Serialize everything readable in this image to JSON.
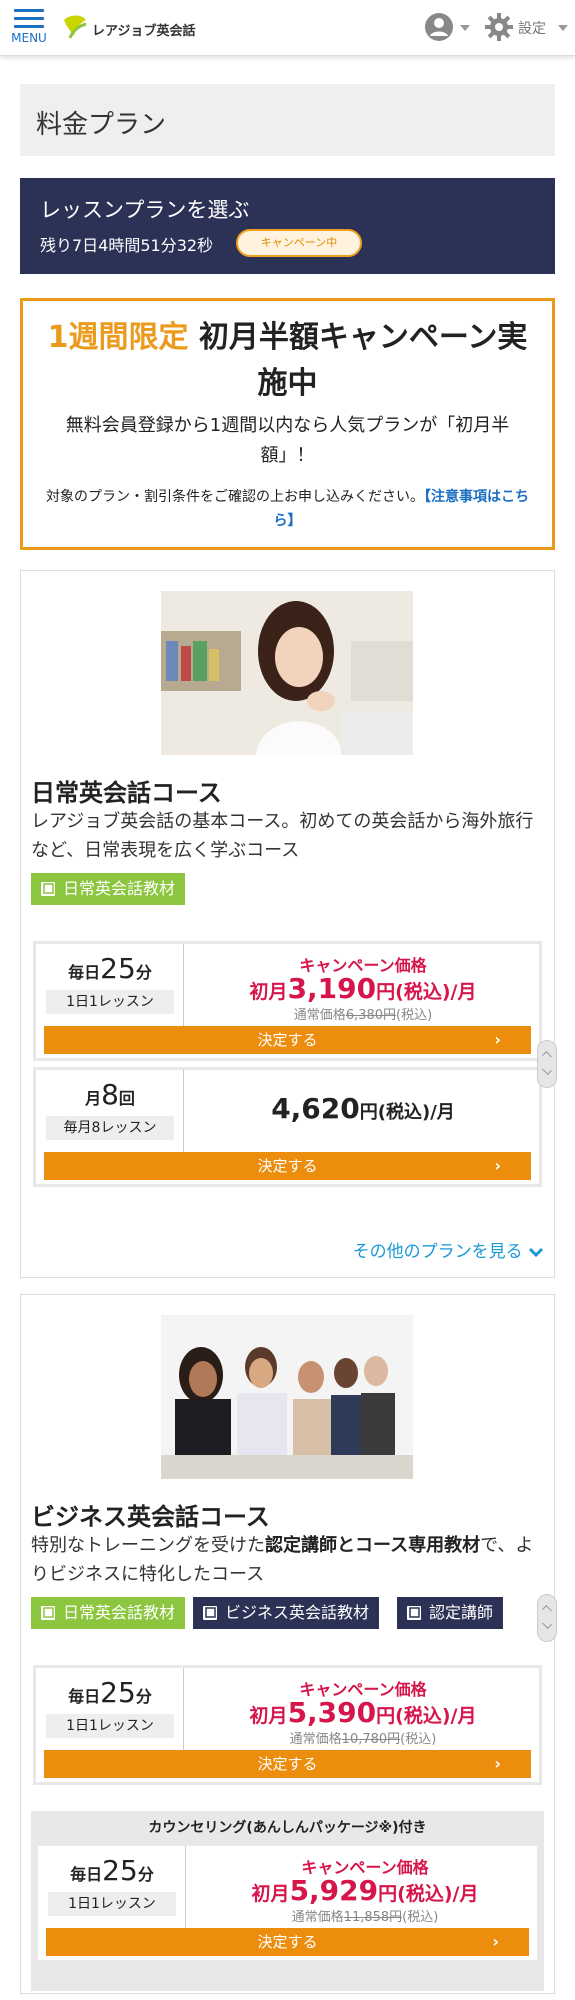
{
  "header": {
    "menu_label": "MENU",
    "logo_text": "レアジョブ英会話",
    "settings_label": "設定"
  },
  "page": {
    "title": "料金プラン"
  },
  "plan_bar": {
    "title": "レッスンプランを選ぶ",
    "countdown": "残り7日4時間51分32秒",
    "badge": "キャンペーン中"
  },
  "campaign": {
    "headline_highlight": "1週間限定",
    "headline_rest": " 初月半額キャンペーン実施中",
    "subtext": "無料会員登録から1週間以内なら人気プランが「初月半額」！",
    "note": "対象のプラン・割引条件をご確認の上お申し込みください。",
    "note_link": "【注意事項はこちら】"
  },
  "courses": [
    {
      "title": "日常英会話コース",
      "description": "レアジョブ英会話の基本コース。初めての英会話から海外旅行など、日常表現を広く学ぶコース",
      "tags": [
        "日常英会話教材"
      ],
      "plans": [
        {
          "freq_prefix": "毎日",
          "freq_num": "25",
          "freq_unit": "分",
          "lesson": "1日1レッスン",
          "campaign_label": "キャンペーン価格",
          "price_prefix": "初月",
          "price": "3,190",
          "price_suffix": "円(税込)/月",
          "regular_prefix": "通常価格",
          "regular_price": "6,380円",
          "regular_suffix": "(税込)",
          "button": "決定する"
        },
        {
          "freq_prefix": "月",
          "freq_num": "8",
          "freq_unit": "回",
          "lesson": "毎月8レッスン",
          "price": "4,620",
          "price_suffix": "円(税込)/月",
          "button": "決定する"
        }
      ],
      "more_link": "その他のプランを見る"
    },
    {
      "title": "ビジネス英会話コース",
      "description_pre": "特別なトレーニングを受けた",
      "description_bold": "認定講師とコース専用教材",
      "description_post": "で、よりビジネスに特化したコース",
      "tags": [
        "日常英会話教材",
        "ビジネス英会話教材",
        "認定講師"
      ],
      "plans": [
        {
          "freq_prefix": "毎日",
          "freq_num": "25",
          "freq_unit": "分",
          "lesson": "1日1レッスン",
          "campaign_label": "キャンペーン価格",
          "price_prefix": "初月",
          "price": "5,390",
          "price_suffix": "円(税込)/月",
          "regular_prefix": "通常価格",
          "regular_price": "10,780円",
          "regular_suffix": "(税込)",
          "button": "決定する"
        }
      ],
      "counseling": {
        "header": "カウンセリング(あんしんパッケージ※)付き",
        "plan": {
          "freq_prefix": "毎日",
          "freq_num": "25",
          "freq_unit": "分",
          "lesson": "1日1レッスン",
          "campaign_label": "キャンペーン価格",
          "price_prefix": "初月",
          "price": "5,929",
          "price_suffix": "円(税込)/月",
          "regular_prefix": "通常価格",
          "regular_price": "11,858円",
          "regular_suffix": "(税込)",
          "button": "決定する"
        }
      }
    }
  ],
  "colors": {
    "brand_blue": "#1a6fc4",
    "navy": "#2c3256",
    "orange": "#ec9a1c",
    "button_orange": "#ec8d0e",
    "campaign_red": "#d6164b",
    "tag_green": "#8cc63f"
  }
}
